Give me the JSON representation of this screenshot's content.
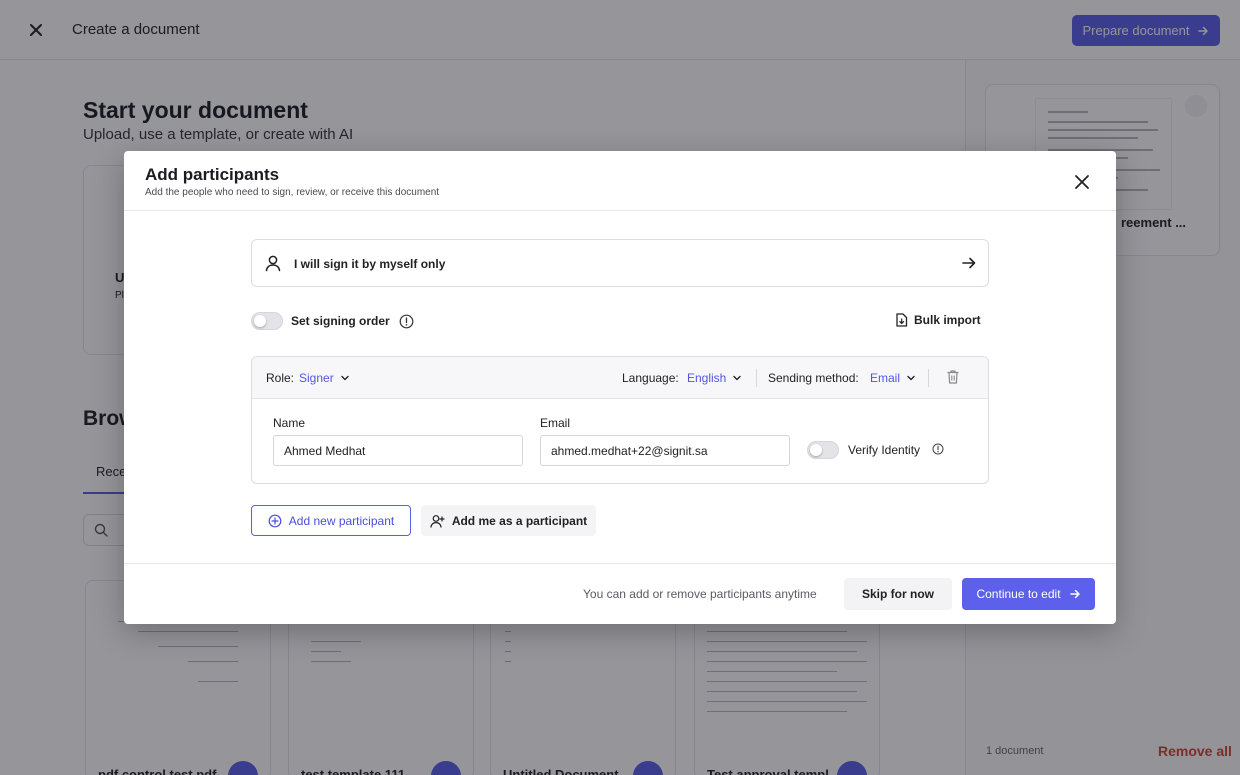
{
  "topbar": {
    "title": "Create a document",
    "prepare_label": "Prepare document"
  },
  "background": {
    "heading": "Start your document",
    "subheading": "Upload, use a template, or create with AI",
    "upload_title": "U",
    "upload_sub": "Pl",
    "browse_heading": "Brow",
    "recent_tab": "Rece",
    "selected_doc_name": "reement ...",
    "document_count": "1 document",
    "remove_all_label": "Remove all",
    "templates": [
      {
        "name": "pdf control test pdf"
      },
      {
        "name": "test template 111"
      },
      {
        "name": "Untitled Document"
      },
      {
        "name": "Test approval templ"
      }
    ]
  },
  "modal": {
    "title": "Add participants",
    "subtitle": "Add the people who need to sign, review, or receive this document",
    "self_sign_label": "I will sign it by myself only",
    "signing_order_label": "Set signing order",
    "signing_order_enabled": false,
    "bulk_import_label": "Bulk import",
    "participant": {
      "role_label": "Role:",
      "role_value": "Signer",
      "language_label": "Language:",
      "language_value": "English",
      "sending_method_label": "Sending method:",
      "sending_method_value": "Email",
      "name_label": "Name",
      "name_value": "Ahmed Medhat",
      "email_label": "Email",
      "email_value": "ahmed.medhat+22@signit.sa",
      "verify_identity_label": "Verify Identity",
      "verify_identity_enabled": false
    },
    "add_new_label": "Add new participant",
    "add_me_label": "Add me as a participant",
    "footer_note": "You can add or remove participants anytime",
    "skip_label": "Skip for now",
    "continue_label": "Continue to edit"
  },
  "colors": {
    "accent": "#5c60ea",
    "danger": "#d2452e",
    "overlay": "rgba(20,20,30,0.45)"
  }
}
